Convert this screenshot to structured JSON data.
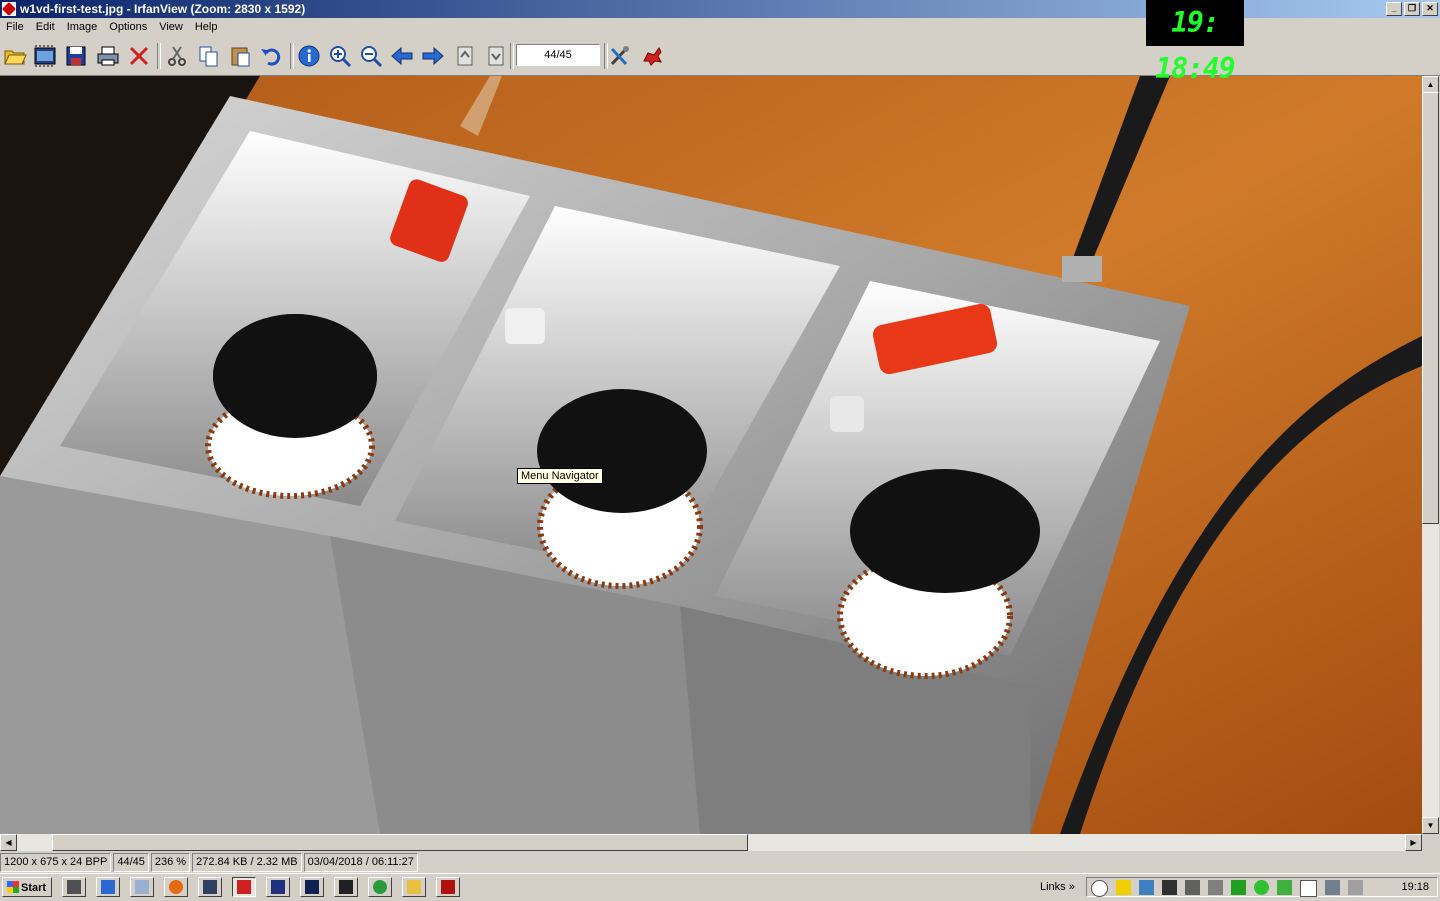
{
  "window": {
    "title": "w1vd-first-test.jpg - IrfanView (Zoom: 2830 x 1592)",
    "controls": [
      "_",
      "❐",
      "✕"
    ]
  },
  "clock_widget": {
    "time": "19: 18:49"
  },
  "menu": [
    "File",
    "Edit",
    "Image",
    "Options",
    "View",
    "Help"
  ],
  "toolbar": {
    "page_indicator": "44/45",
    "buttons": [
      "open-icon",
      "slideshow-icon",
      "save-icon",
      "print-icon",
      "delete-icon",
      "cut-icon",
      "copy-icon",
      "paste-icon",
      "undo-icon",
      "info-icon",
      "zoom-in-icon",
      "zoom-out-icon",
      "previous-icon",
      "next-icon",
      "first-page-icon",
      "last-page-icon",
      "settings-icon",
      "irfanview-logo-icon"
    ]
  },
  "image": {
    "description": "Three aluminum boxes with toroidal coils and red capacitors on wooden table",
    "tooltip": "Menu Navigator"
  },
  "status": {
    "dimensions": "1200 x 675 x 24 BPP",
    "index": "44/45",
    "zoom": "236 %",
    "size": "272.84 KB / 2.32 MB",
    "datetime": "03/04/2018 / 06:11:27"
  },
  "taskbar": {
    "start": "Start",
    "links": "Links",
    "links_chevron": "»",
    "time": "19:18"
  },
  "colors": {
    "titlebar": "#0a246a",
    "clock_digits": "#21ff2a"
  }
}
